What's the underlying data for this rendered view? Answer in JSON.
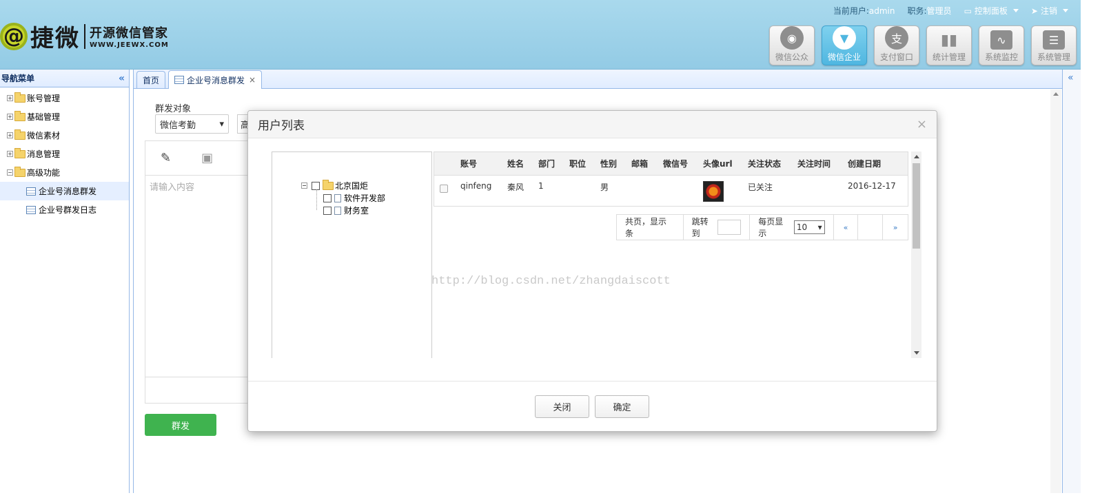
{
  "logo": {
    "mark": "@",
    "name": "捷微",
    "slogan": "开源微信管家",
    "url_text": "WWW.JEEWX.COM"
  },
  "topbar": {
    "user_label": "当前用户:",
    "user_value": "admin",
    "role_label": "职务:",
    "role_value": "管理员",
    "control_panel": "控制面板",
    "logout": "注销"
  },
  "modules": [
    {
      "label": "微信公众",
      "icon": "wechat-icon",
      "active": false
    },
    {
      "label": "微信企业",
      "icon": "tie-icon",
      "active": true
    },
    {
      "label": "支付窗口",
      "icon": "alipay-icon",
      "active": false
    },
    {
      "label": "统计管理",
      "icon": "bar-chart-icon",
      "active": false
    },
    {
      "label": "系统监控",
      "icon": "monitor-icon",
      "active": false
    },
    {
      "label": "系统管理",
      "icon": "settings-icon",
      "active": false
    }
  ],
  "sidebar": {
    "title": "导航菜单",
    "items": [
      {
        "label": "账号管理"
      },
      {
        "label": "基础管理"
      },
      {
        "label": "微信素材"
      },
      {
        "label": "消息管理"
      },
      {
        "label": "高级功能"
      }
    ],
    "subitems": [
      {
        "label": "企业号消息群发"
      },
      {
        "label": "企业号群发日志"
      }
    ]
  },
  "tabs": [
    {
      "label": "首页"
    },
    {
      "label": "企业号消息群发"
    }
  ],
  "form": {
    "target_label": "群发对象",
    "target_value": "微信考勤",
    "second_select": "高",
    "content_placeholder": "请输入内容",
    "send_button": "群发"
  },
  "modal": {
    "title": "用户列表",
    "tree": [
      {
        "label": "北京国炬"
      },
      {
        "label": "软件开发部"
      },
      {
        "label": "财务室"
      }
    ],
    "columns": [
      "账号",
      "姓名",
      "部门",
      "职位",
      "性别",
      "邮箱",
      "微信号",
      "头像url",
      "关注状态",
      "关注时间",
      "创建日期"
    ],
    "rows": [
      {
        "account": "qinfeng",
        "name": "秦风",
        "dept": "1",
        "position": "",
        "gender": "男",
        "email": "",
        "wechat": "",
        "status": "已关注",
        "follow_time": "",
        "created": "2016-12-17"
      }
    ],
    "pager": {
      "summary": "共页，显示条",
      "jump_label": "跳转到",
      "per_page_label": "每页显示",
      "per_page_value": "10",
      "prev": "«",
      "next": "»"
    },
    "close_button": "关闭",
    "confirm_button": "确定"
  },
  "watermark": "http://blog.csdn.net/zhangdaiscott"
}
